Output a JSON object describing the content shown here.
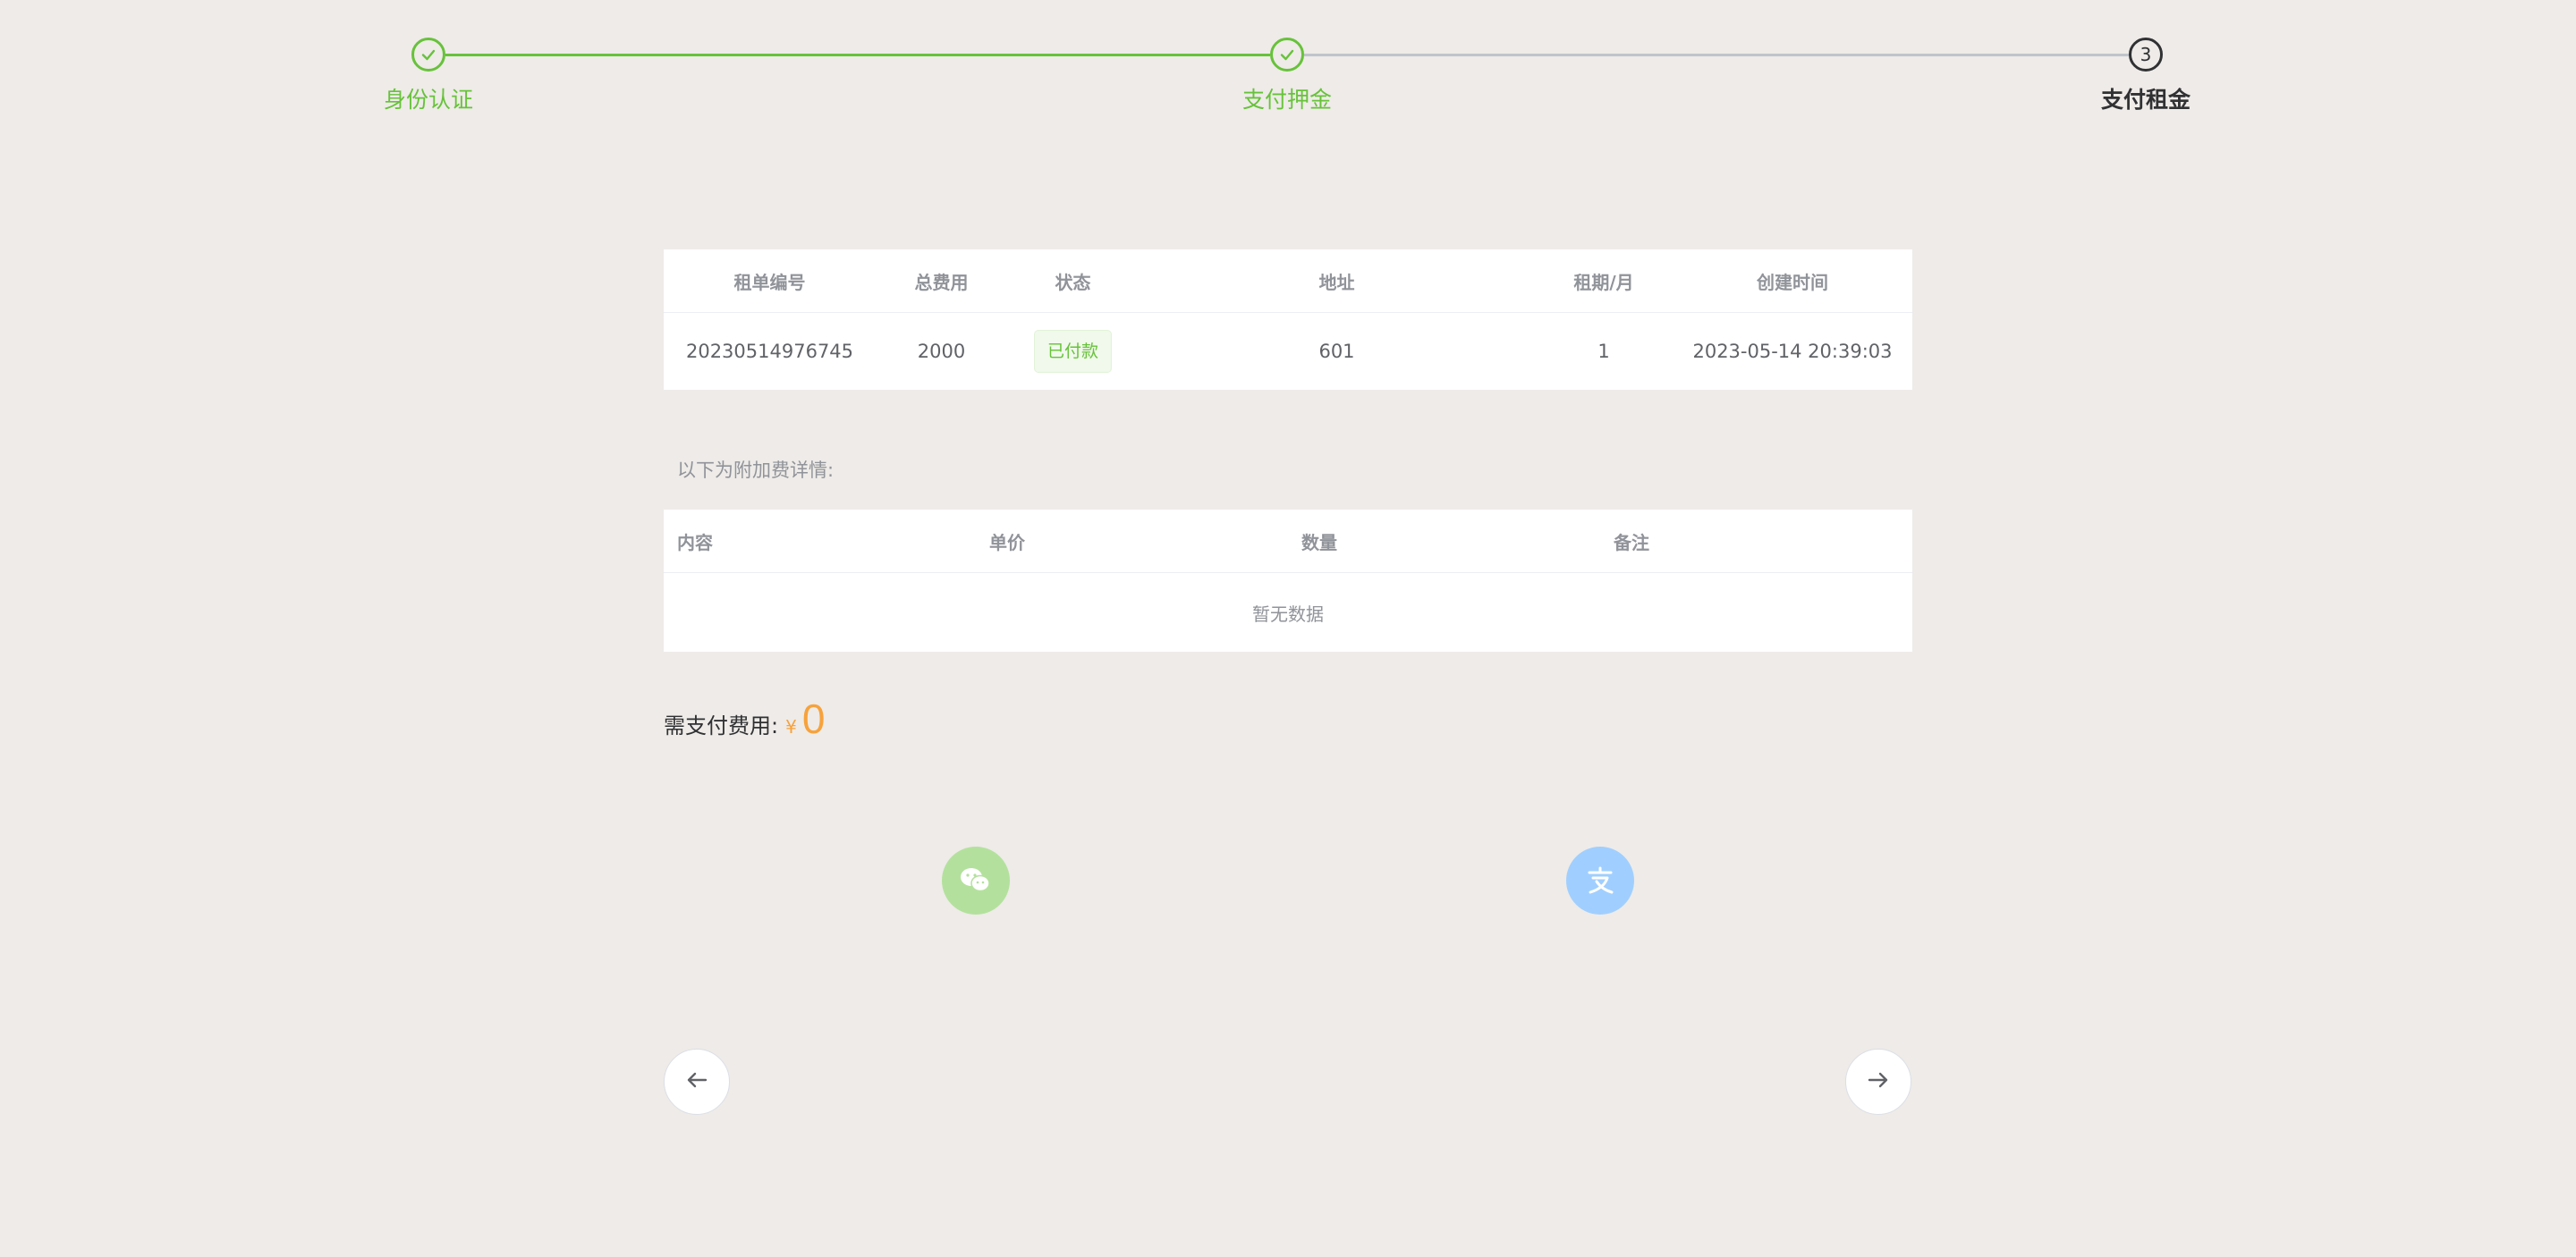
{
  "steps": [
    {
      "label": "身份认证",
      "status": "done",
      "icon": "check-icon"
    },
    {
      "label": "支付押金",
      "status": "done",
      "icon": "check-icon"
    },
    {
      "label": "支付租金",
      "status": "current",
      "number": "3"
    }
  ],
  "orders_table": {
    "headers": [
      "租单编号",
      "总费用",
      "状态",
      "地址",
      "租期/月",
      "创建时间"
    ],
    "rows": [
      {
        "order_no": "20230514976745",
        "total": "2000",
        "status": "已付款",
        "address": "601",
        "term": "1",
        "created": "2023-05-14 20:39:03"
      }
    ]
  },
  "extra_fees": {
    "caption": "以下为附加费详情:",
    "headers": [
      "内容",
      "单价",
      "数量",
      "备注"
    ],
    "empty_text": "暂无数据"
  },
  "payment": {
    "label": "需支付费用:",
    "currency": "¥",
    "amount": "0"
  },
  "pay_methods": [
    {
      "icon": "wechat-pay-icon",
      "color": "#b3e19d"
    },
    {
      "icon": "alipay-icon",
      "color": "#a0cfff"
    }
  ],
  "nav": {
    "prev_icon": "arrow-left-icon",
    "next_icon": "arrow-right-icon"
  },
  "colors": {
    "success": "#67c23a",
    "amount": "#f7a23c",
    "background": "#eeebe8"
  }
}
